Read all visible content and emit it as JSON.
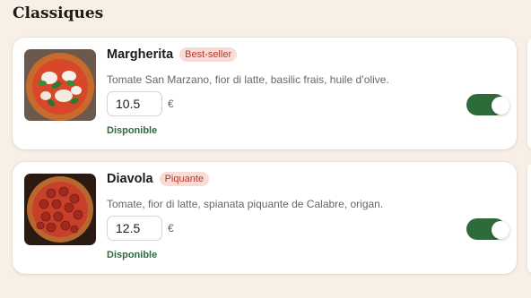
{
  "section": {
    "title": "Classiques"
  },
  "items": [
    {
      "name": "Margherita",
      "badge": "Best-seller",
      "description": "Tomate San Marzano, fior di latte, basilic frais, huile d’olive.",
      "price": "10.5",
      "currency": "€",
      "status": "Disponible",
      "available": true,
      "image_icon": "pizza-margherita-photo"
    },
    {
      "name": "Diavola",
      "badge": "Piquante",
      "description": "Tomate, fior di latte, spianata piquante de Calabre, origan.",
      "price": "12.5",
      "currency": "€",
      "status": "Disponible",
      "available": true,
      "image_icon": "pizza-diavola-photo"
    }
  ],
  "colors": {
    "background": "#f8f0e6",
    "accent_green": "#2e6b3b",
    "badge_bg": "#f9dcd6",
    "badge_text": "#b5382b"
  }
}
